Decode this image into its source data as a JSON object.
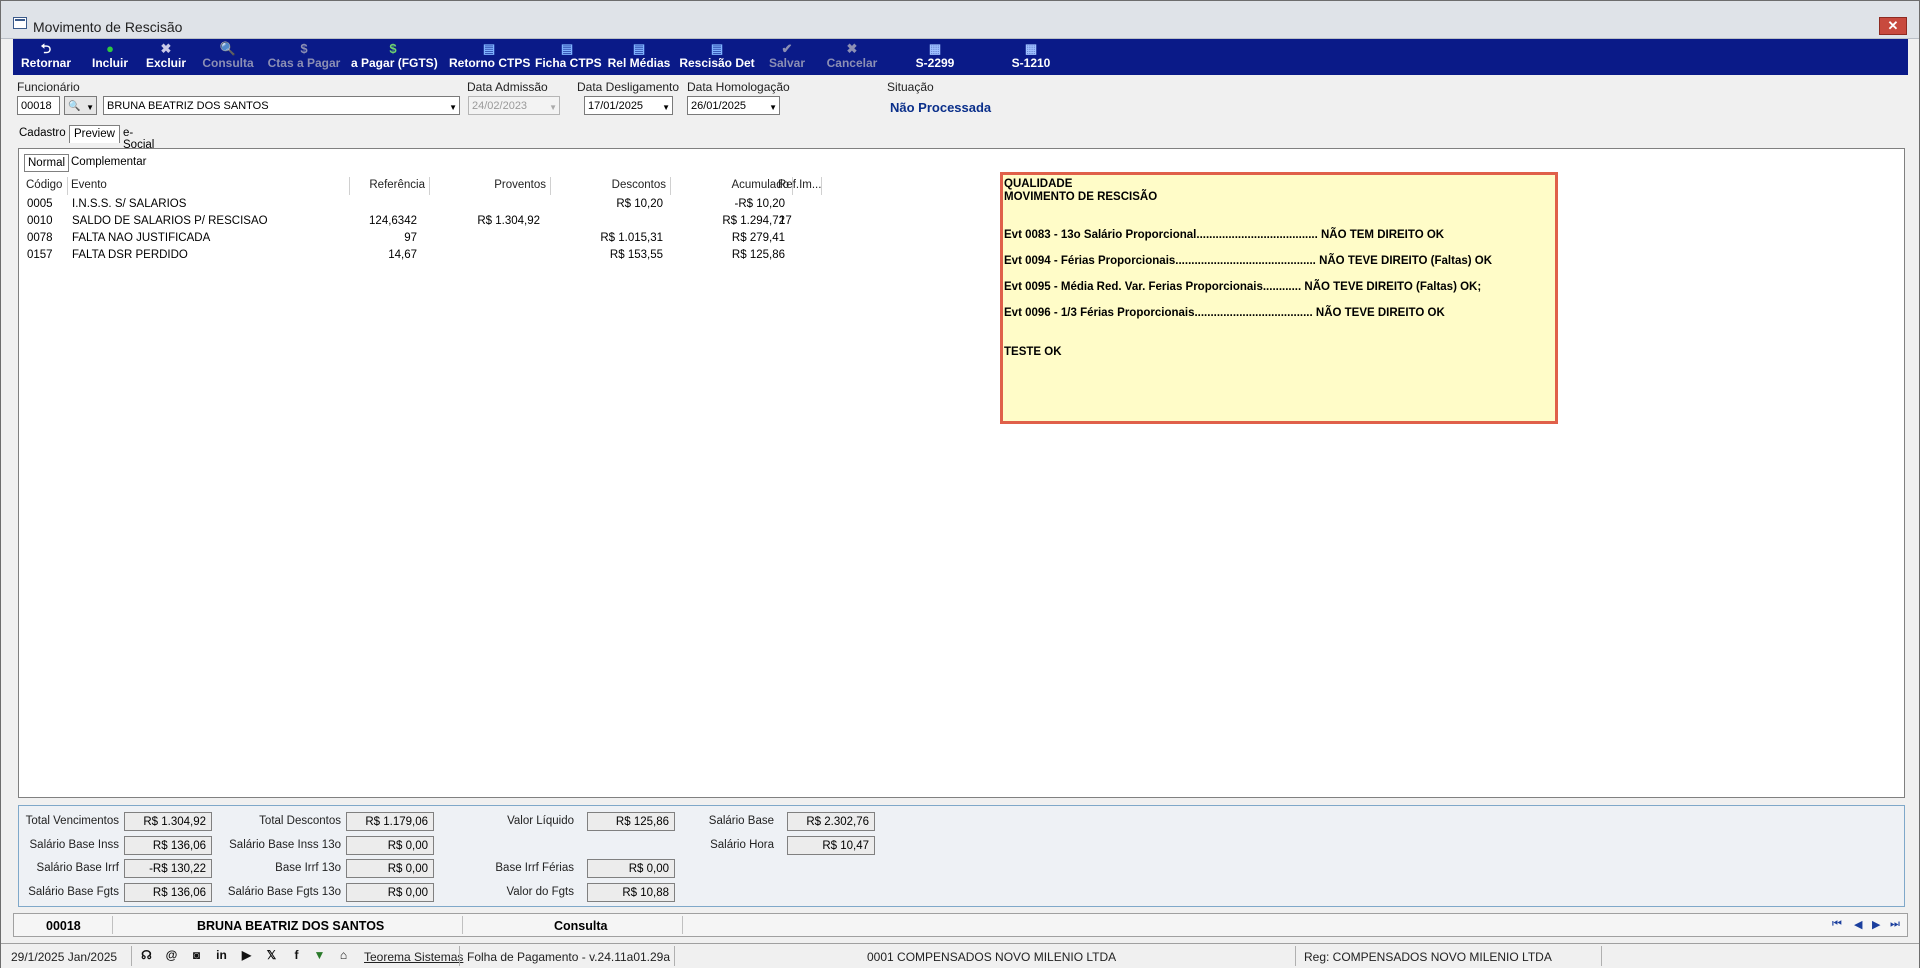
{
  "window": {
    "title": "Movimento de Rescisão",
    "close": "✕"
  },
  "toolbar": [
    {
      "label": "Retornar",
      "icon": "⮌",
      "disabled": false
    },
    {
      "label": "Incluir",
      "icon": "●",
      "disabled": false
    },
    {
      "label": "Excluir",
      "icon": "✖",
      "disabled": false
    },
    {
      "label": "Consulta",
      "icon": "🔍",
      "disabled": true
    },
    {
      "label": "Ctas a Pagar",
      "icon": "$",
      "disabled": true
    },
    {
      "label": "a Pagar (FGTS)",
      "icon": "$",
      "disabled": false
    },
    {
      "label": "Retorno CTPS",
      "icon": "▤",
      "disabled": false
    },
    {
      "label": "Ficha CTPS",
      "icon": "▤",
      "disabled": false
    },
    {
      "label": "Rel Médias",
      "icon": "▤",
      "disabled": false
    },
    {
      "label": "Rescisão Det",
      "icon": "▤",
      "disabled": false
    },
    {
      "label": "Salvar",
      "icon": "✔",
      "disabled": true
    },
    {
      "label": "Cancelar",
      "icon": "✖",
      "disabled": true
    },
    {
      "label": "S-2299",
      "icon": "▦",
      "disabled": false
    },
    {
      "label": "S-1210",
      "icon": "▦",
      "disabled": false
    }
  ],
  "form": {
    "funcionario_label": "Funcionário",
    "funcionario_code": "00018",
    "funcionario_name": "BRUNA BEATRIZ DOS SANTOS",
    "admissao_label": "Data Admissão",
    "admissao_value": "24/02/2023",
    "desligamento_label": "Data Desligamento",
    "desligamento_value": "17/01/2025",
    "homologacao_label": "Data Homologação",
    "homologacao_value": "26/01/2025",
    "situacao_label": "Situação",
    "situacao_value": "Não Processada"
  },
  "tabs": [
    "Cadastro",
    "Preview",
    "e-Social"
  ],
  "subtabs": [
    "Normal",
    "Complementar"
  ],
  "grid": {
    "headers": [
      "Código",
      "Evento",
      "Referência",
      "Proventos",
      "Descontos",
      "Acumulado",
      "Ref.Im..."
    ],
    "rows": [
      [
        "0005",
        "I.N.S.S. S/ SALARIOS",
        "",
        "",
        "R$ 10,20",
        "-R$ 10,20",
        ""
      ],
      [
        "0010",
        "SALDO DE SALARIOS P/ RESCISAO",
        "124,6342",
        "R$ 1.304,92",
        "",
        "R$ 1.294,72",
        "17"
      ],
      [
        "0078",
        "FALTA NAO JUSTIFICADA",
        "97",
        "",
        "R$ 1.015,31",
        "R$ 279,41",
        ""
      ],
      [
        "0157",
        "FALTA DSR PERDIDO",
        "14,67",
        "",
        "R$ 153,55",
        "R$ 125,86",
        ""
      ]
    ]
  },
  "note": {
    "lines": [
      "QUALIDADE",
      "MOVIMENTO DE RESCISÃO",
      "Evt 0083 - 13o Salário Proporcional...................................... NÃO TEM DIREITO OK",
      "Evt 0094 - Férias Proporcionais............................................ NÃO TEVE DIREITO (Faltas) OK",
      "Evt 0095 - Média Red. Var. Ferias Proporcionais............ NÃO TEVE DIREITO (Faltas) OK;",
      "Evt 0096 - 1/3 Férias Proporcionais..................................... NÃO TEVE DIREITO OK",
      "TESTE OK"
    ]
  },
  "totals": {
    "total_vencimentos": {
      "label": "Total Vencimentos",
      "value": "R$ 1.304,92"
    },
    "salario_base_inss": {
      "label": "Salário Base Inss",
      "value": "R$ 136,06"
    },
    "salario_base_irrf": {
      "label": "Salário Base Irrf",
      "value": "-R$ 130,22"
    },
    "salario_base_fgts": {
      "label": "Salário Base Fgts",
      "value": "R$ 136,06"
    },
    "total_descontos": {
      "label": "Total Descontos",
      "value": "R$ 1.179,06"
    },
    "salario_base_inss_13o": {
      "label": "Salário Base Inss 13o",
      "value": "R$ 0,00"
    },
    "base_irrf_13o": {
      "label": "Base Irrf 13o",
      "value": "R$ 0,00"
    },
    "salario_base_fgts_13o": {
      "label": "Salário Base Fgts 13o",
      "value": "R$ 0,00"
    },
    "valor_liquido": {
      "label": "Valor Líquido",
      "value": "R$ 125,86"
    },
    "base_irrf_ferias": {
      "label": "Base Irrf Férias",
      "value": "R$ 0,00"
    },
    "valor_fgts": {
      "label": "Valor do Fgts",
      "value": "R$ 10,88"
    },
    "salario_base": {
      "label": "Salário Base",
      "value": "R$ 2.302,76"
    },
    "salario_hora": {
      "label": "Salário Hora",
      "value": "R$ 10,47"
    }
  },
  "navbar": {
    "code": "00018",
    "name": "BRUNA BEATRIZ DOS SANTOS",
    "mode": "Consulta"
  },
  "status": {
    "date": "29/1/2025 Jan/2025",
    "teorema": "Teorema Sistemas",
    "version": "Folha de Pagamento - v.24.11a01.29a",
    "company": "0001 COMPENSADOS NOVO MILENIO LTDA",
    "reg": "Reg: COMPENSADOS NOVO MILENIO LTDA"
  },
  "social_icons": [
    "headset-icon",
    "at-icon",
    "instagram-icon",
    "linkedin-icon",
    "youtube-icon",
    "twitter-icon",
    "facebook-icon",
    "teorema-logo-icon",
    "academy-icon"
  ]
}
